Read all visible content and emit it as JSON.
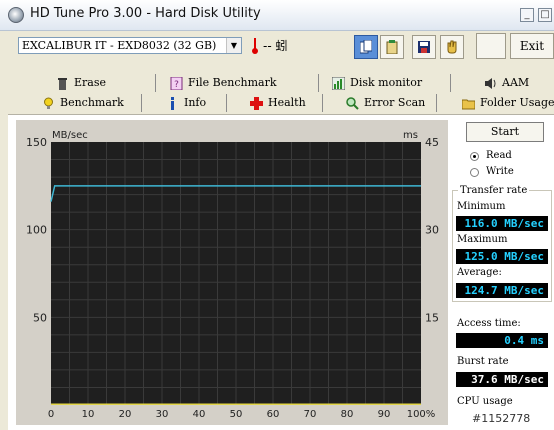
{
  "window": {
    "title": "HD Tune Pro 3.00 - Hard Disk Utility",
    "minimize": "_",
    "maximize": "□"
  },
  "toolbar": {
    "drive": "EXCALIBUR IT - EXD8032 (32 GB)",
    "temperature": "-- 蚓",
    "exit_label": "Exit"
  },
  "tabs": {
    "top": [
      "Erase",
      "File Benchmark",
      "Disk monitor",
      "AAM"
    ],
    "bottom": [
      "Benchmark",
      "Info",
      "Health",
      "Error Scan",
      "Folder Usage"
    ],
    "active": "Benchmark"
  },
  "chart_data": {
    "type": "line",
    "ylabel_left": "MB/sec",
    "ylabel_right": "ms",
    "yticks_left": [
      150,
      100,
      50
    ],
    "yticks_right": [
      45,
      30,
      15
    ],
    "ylim": [
      0,
      150
    ],
    "xticks": [
      "0",
      "10",
      "20",
      "30",
      "40",
      "50",
      "60",
      "70",
      "80",
      "90",
      "100%"
    ],
    "series": [
      {
        "color": "#3fb7d4",
        "x": [
          0,
          1,
          2,
          100
        ],
        "y": [
          116,
          125,
          125,
          125
        ]
      },
      {
        "color": "#e3d64a",
        "x": [
          0,
          100
        ],
        "y": [
          0.4,
          0.4
        ]
      }
    ],
    "grid": true
  },
  "panel": {
    "start_label": "Start",
    "read_label": "Read",
    "write_label": "Write",
    "mode": "Read",
    "transfer_rate_label": "Transfer rate",
    "minimum_label": "Minimum",
    "minimum_value": "116.0 MB/sec",
    "maximum_label": "Maximum",
    "maximum_value": "125.0 MB/sec",
    "average_label": "Average:",
    "average_value": "124.7 MB/sec",
    "access_time_label": "Access time:",
    "access_time_value": "0.4 ms",
    "burst_rate_label": "Burst rate",
    "burst_rate_value": "37.6 MB/sec",
    "cpu_usage_label": "CPU usage"
  },
  "watermark": "#1152778",
  "colors": {
    "chart_bg": "#1f1f1f",
    "grid": "#3a3a3a",
    "value_text": "#25d1ff",
    "accent_blue": "#5a8fd8"
  }
}
